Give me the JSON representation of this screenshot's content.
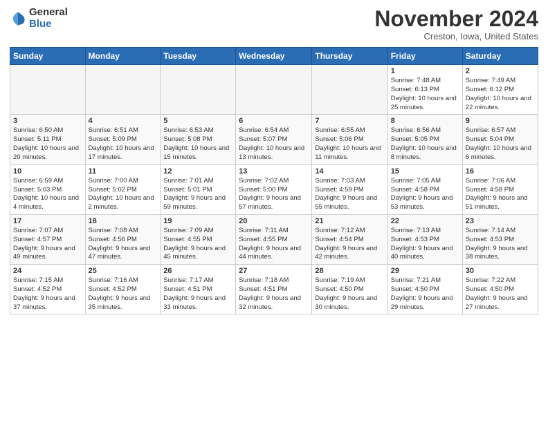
{
  "logo": {
    "general": "General",
    "blue": "Blue"
  },
  "title": "November 2024",
  "location": "Creston, Iowa, United States",
  "weekdays": [
    "Sunday",
    "Monday",
    "Tuesday",
    "Wednesday",
    "Thursday",
    "Friday",
    "Saturday"
  ],
  "weeks": [
    [
      {
        "day": "",
        "info": ""
      },
      {
        "day": "",
        "info": ""
      },
      {
        "day": "",
        "info": ""
      },
      {
        "day": "",
        "info": ""
      },
      {
        "day": "",
        "info": ""
      },
      {
        "day": "1",
        "info": "Sunrise: 7:48 AM\nSunset: 6:13 PM\nDaylight: 10 hours\nand 25 minutes."
      },
      {
        "day": "2",
        "info": "Sunrise: 7:49 AM\nSunset: 6:12 PM\nDaylight: 10 hours\nand 22 minutes."
      }
    ],
    [
      {
        "day": "3",
        "info": "Sunrise: 6:50 AM\nSunset: 5:11 PM\nDaylight: 10 hours\nand 20 minutes."
      },
      {
        "day": "4",
        "info": "Sunrise: 6:51 AM\nSunset: 5:09 PM\nDaylight: 10 hours\nand 17 minutes."
      },
      {
        "day": "5",
        "info": "Sunrise: 6:53 AM\nSunset: 5:08 PM\nDaylight: 10 hours\nand 15 minutes."
      },
      {
        "day": "6",
        "info": "Sunrise: 6:54 AM\nSunset: 5:07 PM\nDaylight: 10 hours\nand 13 minutes."
      },
      {
        "day": "7",
        "info": "Sunrise: 6:55 AM\nSunset: 5:06 PM\nDaylight: 10 hours\nand 11 minutes."
      },
      {
        "day": "8",
        "info": "Sunrise: 6:56 AM\nSunset: 5:05 PM\nDaylight: 10 hours\nand 8 minutes."
      },
      {
        "day": "9",
        "info": "Sunrise: 6:57 AM\nSunset: 5:04 PM\nDaylight: 10 hours\nand 6 minutes."
      }
    ],
    [
      {
        "day": "10",
        "info": "Sunrise: 6:59 AM\nSunset: 5:03 PM\nDaylight: 10 hours\nand 4 minutes."
      },
      {
        "day": "11",
        "info": "Sunrise: 7:00 AM\nSunset: 5:02 PM\nDaylight: 10 hours\nand 2 minutes."
      },
      {
        "day": "12",
        "info": "Sunrise: 7:01 AM\nSunset: 5:01 PM\nDaylight: 9 hours\nand 59 minutes."
      },
      {
        "day": "13",
        "info": "Sunrise: 7:02 AM\nSunset: 5:00 PM\nDaylight: 9 hours\nand 57 minutes."
      },
      {
        "day": "14",
        "info": "Sunrise: 7:03 AM\nSunset: 4:59 PM\nDaylight: 9 hours\nand 55 minutes."
      },
      {
        "day": "15",
        "info": "Sunrise: 7:05 AM\nSunset: 4:58 PM\nDaylight: 9 hours\nand 53 minutes."
      },
      {
        "day": "16",
        "info": "Sunrise: 7:06 AM\nSunset: 4:58 PM\nDaylight: 9 hours\nand 51 minutes."
      }
    ],
    [
      {
        "day": "17",
        "info": "Sunrise: 7:07 AM\nSunset: 4:57 PM\nDaylight: 9 hours\nand 49 minutes."
      },
      {
        "day": "18",
        "info": "Sunrise: 7:08 AM\nSunset: 4:56 PM\nDaylight: 9 hours\nand 47 minutes."
      },
      {
        "day": "19",
        "info": "Sunrise: 7:09 AM\nSunset: 4:55 PM\nDaylight: 9 hours\nand 45 minutes."
      },
      {
        "day": "20",
        "info": "Sunrise: 7:11 AM\nSunset: 4:55 PM\nDaylight: 9 hours\nand 44 minutes."
      },
      {
        "day": "21",
        "info": "Sunrise: 7:12 AM\nSunset: 4:54 PM\nDaylight: 9 hours\nand 42 minutes."
      },
      {
        "day": "22",
        "info": "Sunrise: 7:13 AM\nSunset: 4:53 PM\nDaylight: 9 hours\nand 40 minutes."
      },
      {
        "day": "23",
        "info": "Sunrise: 7:14 AM\nSunset: 4:53 PM\nDaylight: 9 hours\nand 38 minutes."
      }
    ],
    [
      {
        "day": "24",
        "info": "Sunrise: 7:15 AM\nSunset: 4:52 PM\nDaylight: 9 hours\nand 37 minutes."
      },
      {
        "day": "25",
        "info": "Sunrise: 7:16 AM\nSunset: 4:52 PM\nDaylight: 9 hours\nand 35 minutes."
      },
      {
        "day": "26",
        "info": "Sunrise: 7:17 AM\nSunset: 4:51 PM\nDaylight: 9 hours\nand 33 minutes."
      },
      {
        "day": "27",
        "info": "Sunrise: 7:18 AM\nSunset: 4:51 PM\nDaylight: 9 hours\nand 32 minutes."
      },
      {
        "day": "28",
        "info": "Sunrise: 7:19 AM\nSunset: 4:50 PM\nDaylight: 9 hours\nand 30 minutes."
      },
      {
        "day": "29",
        "info": "Sunrise: 7:21 AM\nSunset: 4:50 PM\nDaylight: 9 hours\nand 29 minutes."
      },
      {
        "day": "30",
        "info": "Sunrise: 7:22 AM\nSunset: 4:50 PM\nDaylight: 9 hours\nand 27 minutes."
      }
    ]
  ]
}
